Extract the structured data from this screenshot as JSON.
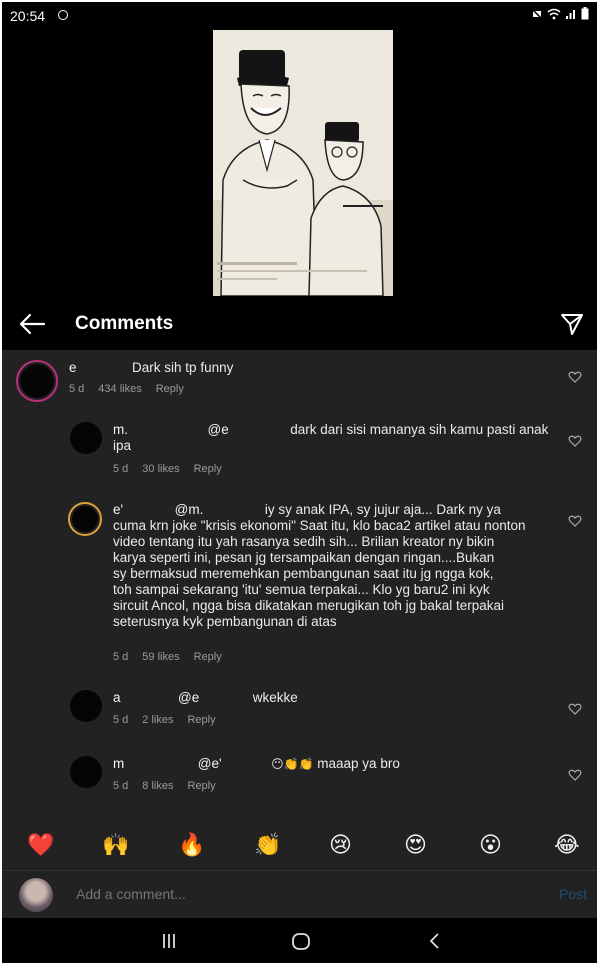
{
  "status_bar": {
    "time": "20:54"
  },
  "header": {
    "title": "Comments"
  },
  "comments": [
    {
      "username": "e",
      "body": "Dark sih tp funny",
      "age": "5 d",
      "likes": "434 likes",
      "reply": "Reply"
    },
    {
      "username": "m.",
      "mention": "@e",
      "body": "dark dari sisi mananya sih kamu pasti anak",
      "body_cont": "ipa",
      "age": "5 d",
      "likes": "30 likes",
      "reply": "Reply"
    },
    {
      "username": "e'",
      "mention": "@m.",
      "body_lines": [
        "iy sy anak IPA, sy jujur aja... Dark ny ya",
        "cuma krn joke \"krisis ekonomi\" Saat itu, klo baca2 artikel atau nonton",
        "video tentang itu yah rasanya sedih sih... Brilian kreator ny bikin",
        "karya seperti ini, pesan jg tersampaikan dengan ringan....Bukan",
        "sy bermaksud meremehkan pembangunan saat itu jg ngga kok,",
        "toh sampai sekarang 'itu' semua terpakai... Klo yg baru2 ini kyk",
        "sircuit Ancol, ngga bisa dikatakan merugikan toh jg bakal terpakai",
        "seterusnya kyk pembangunan di atas"
      ],
      "age": "5 d",
      "likes": "59 likes",
      "reply": "Reply"
    },
    {
      "username": "a",
      "mention": "@e",
      "body": "wkekke",
      "age": "5 d",
      "likes": "2 likes",
      "reply": "Reply"
    },
    {
      "username": "m",
      "mention": "@e'",
      "emojis": "😶👏👏",
      "body": "maaap ya bro",
      "age": "5 d",
      "likes": "8 likes",
      "reply": "Reply"
    }
  ],
  "emoji_bar": [
    "❤️",
    "🙌",
    "🔥",
    "👏",
    "😢",
    "😍",
    "😮",
    "😂"
  ],
  "add_comment": {
    "placeholder": "Add a comment...",
    "post_label": "Post"
  },
  "colors": {
    "background": "#222222",
    "header": "#000000",
    "post": "#1c4f77"
  }
}
